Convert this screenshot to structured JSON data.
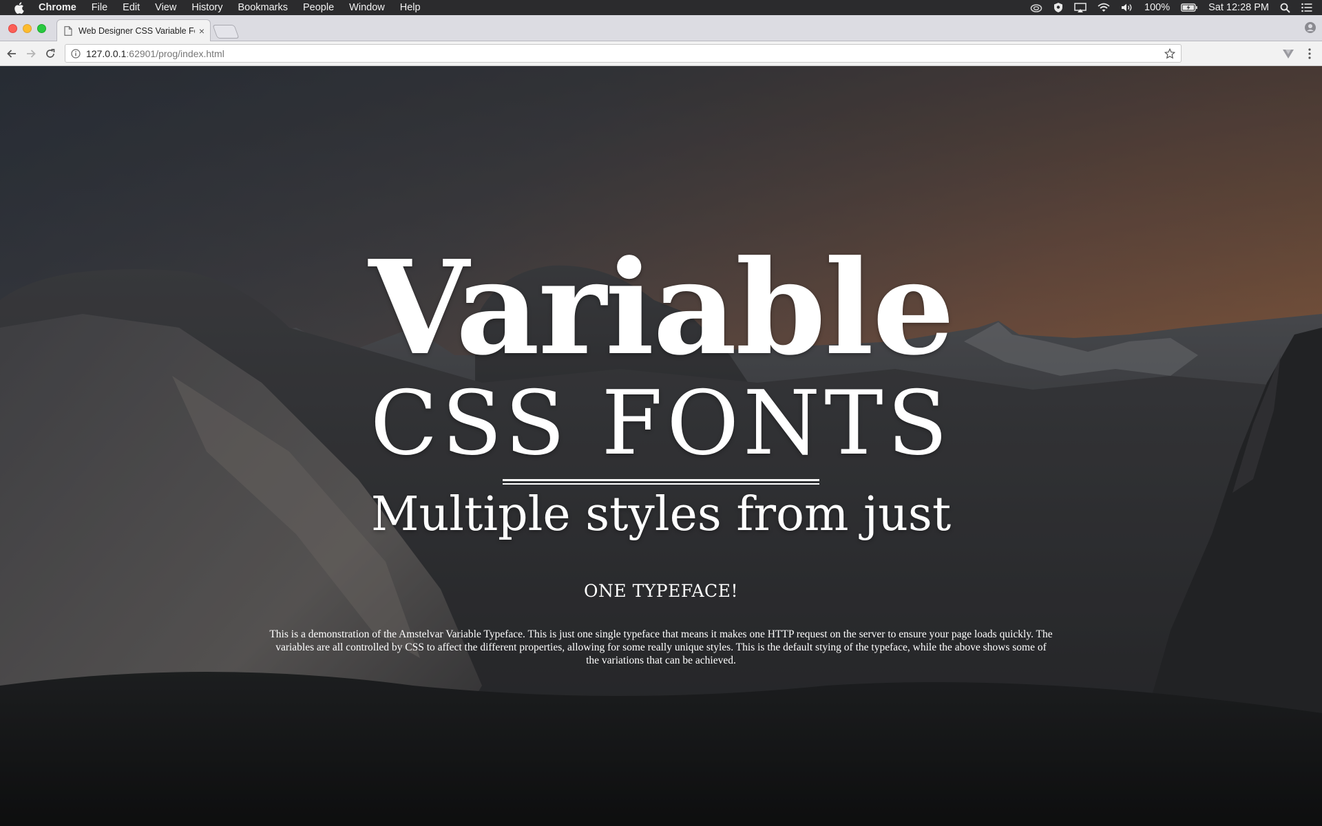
{
  "menubar": {
    "app_name": "Chrome",
    "items": [
      "File",
      "Edit",
      "View",
      "History",
      "Bookmarks",
      "People",
      "Window",
      "Help"
    ],
    "battery": "100%",
    "clock": "Sat 12:28 PM"
  },
  "tab": {
    "title": "Web Designer CSS Variable Fo",
    "close_glyph": "×"
  },
  "address_bar": {
    "host": "127.0.0.1",
    "path": ":62901/prog/index.html"
  },
  "page": {
    "title_large": "Variable",
    "title_secondary": "CSS FONTS",
    "subtitle": "Multiple styles from just",
    "tagline": "ONE TYPEFACE!",
    "description": "This is a demonstration of the Amstelvar Variable Typeface. This is just one single typeface that means it makes one HTTP request on the server to ensure your page loads quickly. The variables are all controlled by CSS to affect the different properties, allowing for some really unique styles. This is the default stying of the typeface, while the above shows some of the variations that can be achieved."
  },
  "colors": {
    "menubar_bg": "#2b2b2d",
    "tabstrip_bg": "#dcdce2",
    "toolbar_bg": "#f2f2f2",
    "text_on_hero": "#ffffff",
    "sky_orange": "#b0714a",
    "sky_dark": "#3e4653"
  },
  "icons": {
    "menubar": [
      "apple-icon",
      "creative-cloud-icon",
      "shield-icon",
      "airplay-icon",
      "wifi-icon",
      "volume-icon",
      "battery-icon",
      "spotlight-search-icon",
      "notification-center-icon"
    ],
    "tabstrip": [
      "page-icon",
      "close-icon",
      "new-tab-icon",
      "profile-icon"
    ],
    "toolbar": [
      "back-arrow-icon",
      "forward-arrow-icon",
      "reload-icon",
      "info-icon",
      "star-icon",
      "extension-icon",
      "menu-dots-icon"
    ]
  }
}
